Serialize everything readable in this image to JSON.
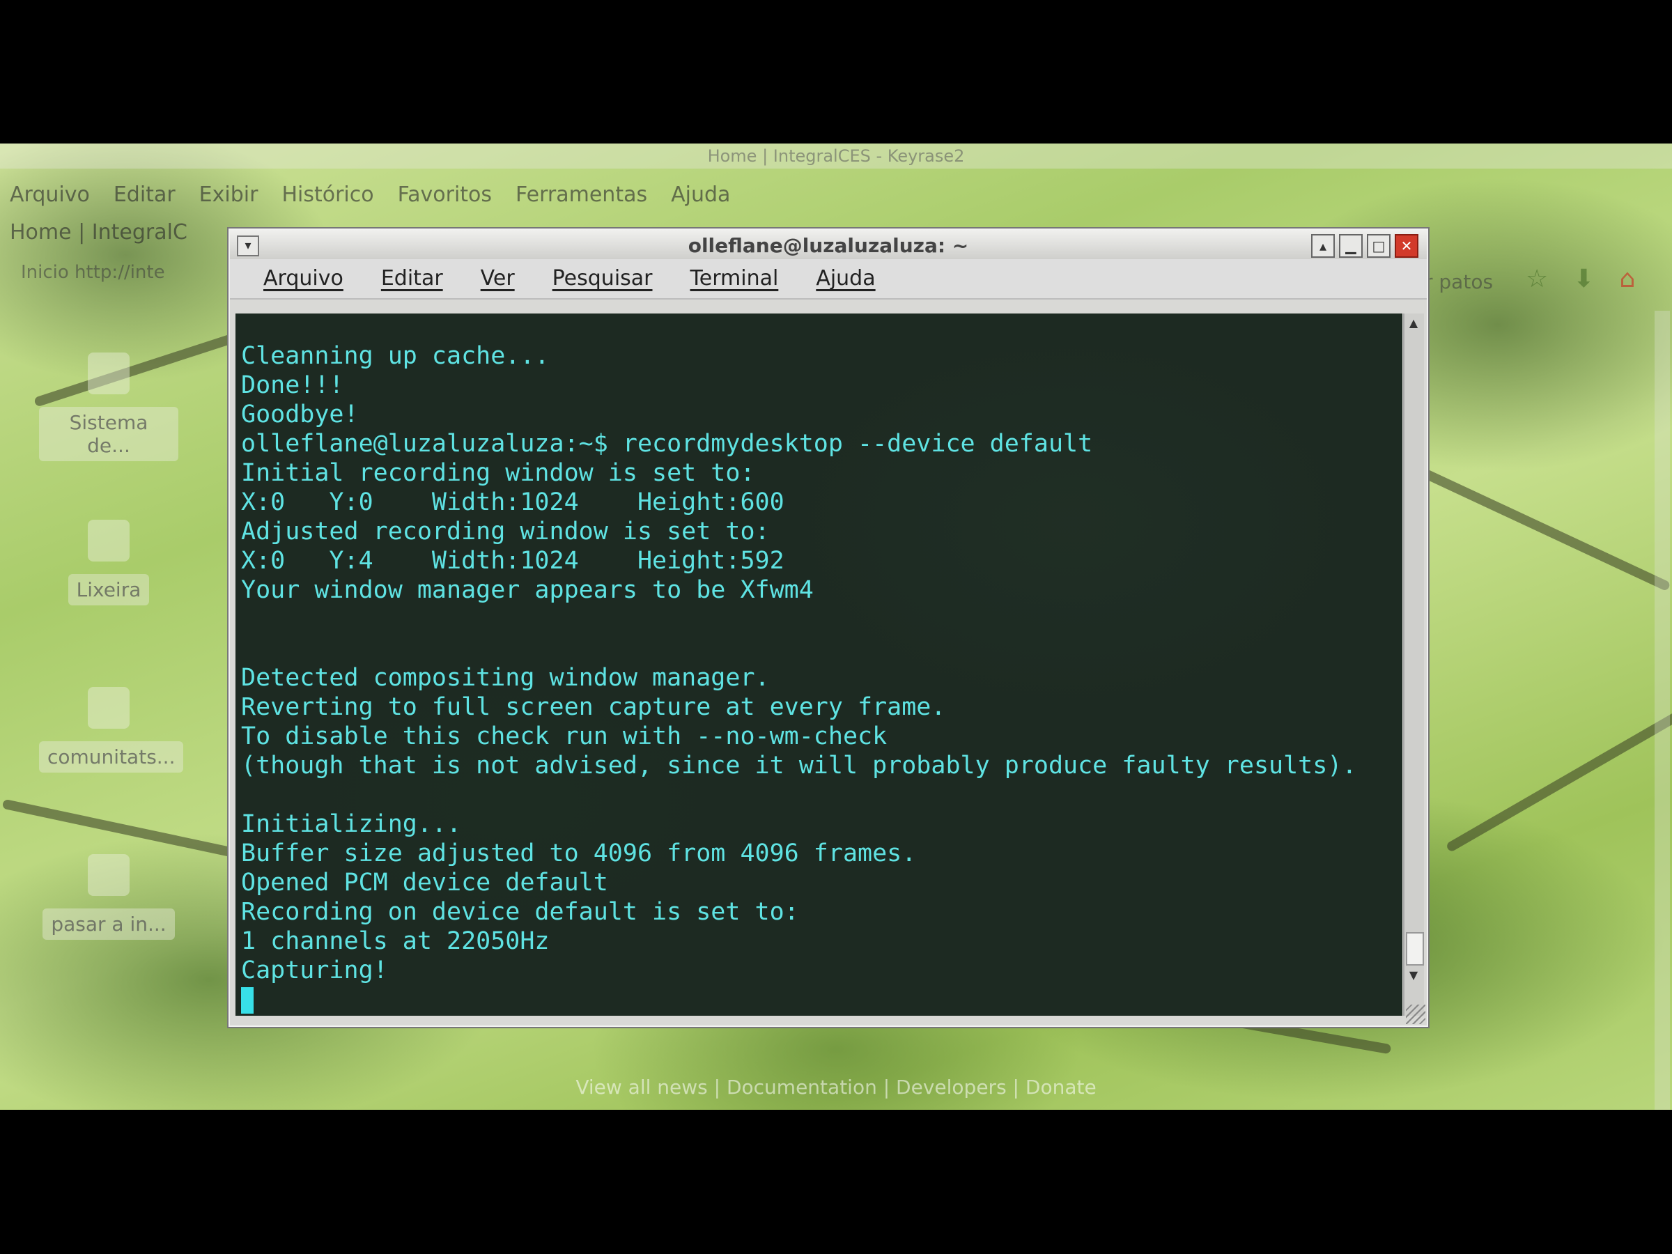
{
  "browser": {
    "window_title": "Home | IntegralCES - Keyrase2",
    "menu": [
      "Arquivo",
      "Editar",
      "Exibir",
      "Histórico",
      "Favoritos",
      "Ferramentas",
      "Ajuda"
    ],
    "tab": "Home | IntegralC",
    "nav_text": "Inicio  http://inte",
    "url_right": "r patos",
    "footer": "View all news  |  Documentation  |  Developers  |  Donate"
  },
  "desktop_icons": [
    {
      "label": "Sistema de...",
      "icon": "system-icon"
    },
    {
      "label": "Lixeira",
      "icon": "trash-icon"
    },
    {
      "label": "comunitats...",
      "icon": "image-icon"
    },
    {
      "label": "pasar a in...",
      "icon": "image-icon"
    }
  ],
  "terminal": {
    "title": "olleflane@luzaluzaluza: ~",
    "menu": [
      "Arquivo",
      "Editar",
      "Ver",
      "Pesquisar",
      "Terminal",
      "Ajuda"
    ],
    "lines": [
      "Cleanning up cache...",
      "Done!!!",
      "Goodbye!",
      "olleflane@luzaluzaluza:~$ recordmydesktop --device default",
      "Initial recording window is set to:",
      "X:0   Y:0    Width:1024    Height:600",
      "Adjusted recording window is set to:",
      "X:0   Y:4    Width:1024    Height:592",
      "Your window manager appears to be Xfwm4",
      "",
      "",
      "Detected compositing window manager.",
      "Reverting to full screen capture at every frame.",
      "To disable this check run with --no-wm-check",
      "(though that is not advised, since it will probably produce faulty results).",
      "",
      "Initializing...",
      "Buffer size adjusted to 4096 from 4096 frames.",
      "Opened PCM device default",
      "Recording on device default is set to:",
      "1 channels at 22050Hz",
      "Capturing!"
    ],
    "text_color": "#5fe3e3",
    "background_color": "#08160e"
  }
}
